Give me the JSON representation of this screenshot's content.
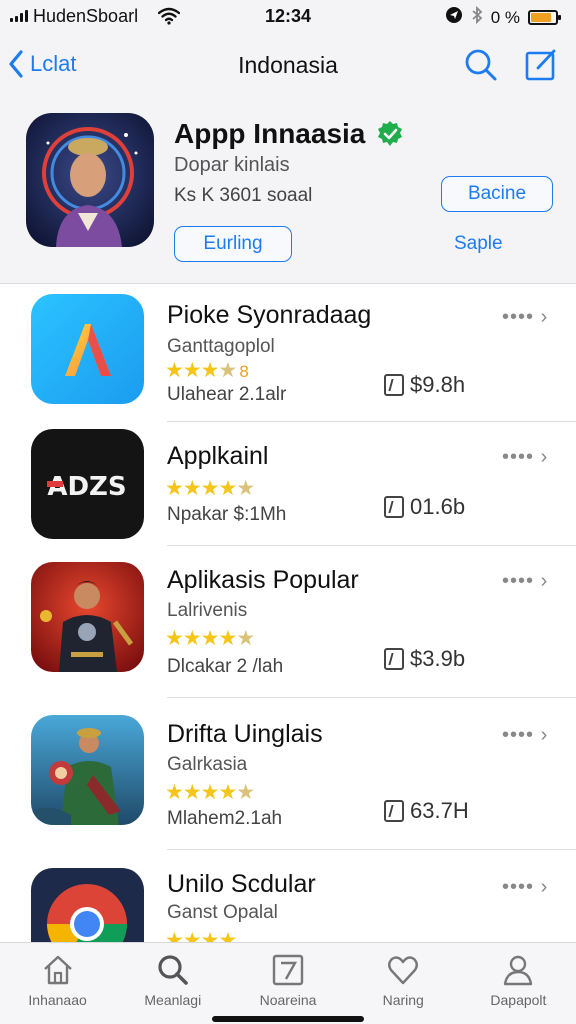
{
  "status_bar": {
    "carrier": "HudenSboarl",
    "time": "12:34",
    "battery_text": "0 %",
    "battery_fill_percent": 85
  },
  "nav": {
    "back_label": "Lclat",
    "title": "Indonasia"
  },
  "featured": {
    "title": "Appp Innaasia",
    "subtitle": "Dopar kinlais",
    "meta": "Ks K 3601 soaal",
    "right_button": "Bacine",
    "left_button": "Eurling",
    "link": "Saple"
  },
  "apps": [
    {
      "name": "Pioke Syonradaag",
      "subtitle": "Ganttagoplol",
      "stars_text": "8",
      "meta": "Ulahear 2.1alr",
      "size": "$9.8h"
    },
    {
      "name": "Applkainl",
      "subtitle": "",
      "icon_text": "ADZS",
      "meta": "Npakar $:1Mh",
      "size": "01.6b"
    },
    {
      "name": "Aplikasis Popular",
      "subtitle": "Lalrivenis",
      "meta": "Dlcakar 2 /lah",
      "size": "$3.9b"
    },
    {
      "name": "Drifta Uinglais",
      "subtitle": "Galrkasia",
      "meta": "Mlahem2.1ah",
      "size": "63.7H"
    },
    {
      "name": "Unilo Scdular",
      "subtitle": "Ganst Opalal",
      "meta": "",
      "size": ""
    }
  ],
  "tabs": [
    {
      "label": "Inhanaao",
      "icon": "home-icon"
    },
    {
      "label": "Meanlagi",
      "icon": "search-icon"
    },
    {
      "label": "Noareina",
      "icon": "compose-icon"
    },
    {
      "label": "Naring",
      "icon": "heart-icon"
    },
    {
      "label": "Dapapolt",
      "icon": "profile-icon"
    }
  ],
  "colors": {
    "accent": "#1d7cf2",
    "star": "#f5c518",
    "verified": "#1fae4b"
  }
}
